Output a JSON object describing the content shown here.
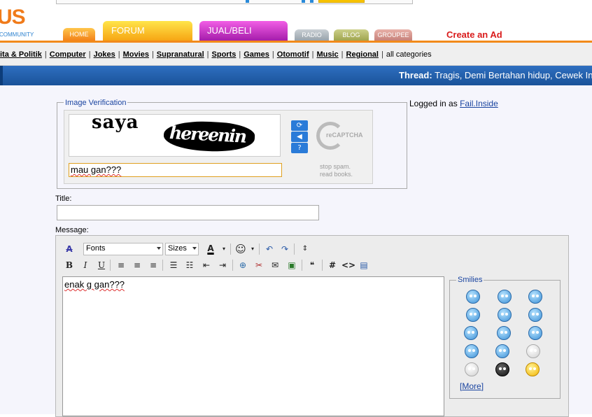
{
  "header": {
    "logo_text": "US",
    "logo_sub": "COMMUNITY",
    "tabs": {
      "home": "HOME",
      "forum": "FORUM",
      "jual_beli": "JUAL/BELI",
      "radio": "RADIO",
      "blog": "BLOG",
      "groupee": "GROUPEE"
    },
    "create_ad": "Create an Ad"
  },
  "categories": {
    "items": [
      "ita & Politik",
      "Computer",
      "Jokes",
      "Movies",
      "Supranatural",
      "Sports",
      "Games",
      "Otomotif",
      "Music",
      "Regional"
    ],
    "separator": "|",
    "all": "all categories"
  },
  "thread": {
    "label": "Thread:",
    "title": "Tragis, Demi Bertahan hidup, Cewek In"
  },
  "image_verification": {
    "legend": "Image Verification",
    "captcha_word1": "saya",
    "captcha_word2": "hereenin",
    "input_value": "mau gan???",
    "recaptcha_logo": "reCAPTCHA",
    "slogan_line1": "stop spam.",
    "slogan_line2": "read books."
  },
  "login": {
    "prefix": "Logged in as",
    "username": "Fail.Inside"
  },
  "form": {
    "title_label": "Title:",
    "title_value": "",
    "message_label": "Message:",
    "message_value": "enak g gan???"
  },
  "toolbar": {
    "fonts": "Fonts",
    "sizes": "Sizes"
  },
  "smilies": {
    "legend": "Smilies",
    "more": "More",
    "more_open": "[",
    "more_close": "]"
  }
}
